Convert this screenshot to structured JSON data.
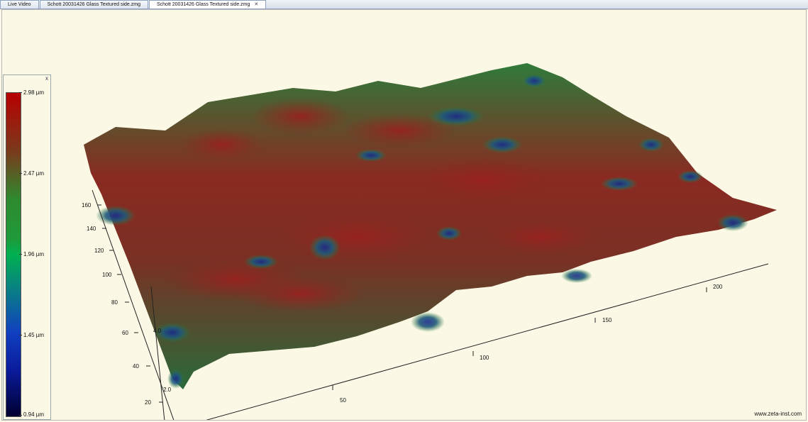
{
  "tabs": [
    {
      "label": "Live Video",
      "active": false
    },
    {
      "label": "Schott 20031426 Glass Textured side.zmg",
      "active": false
    },
    {
      "label": "Schott 20031426 Glass Textured side.zmg",
      "active": true,
      "close": "✕"
    }
  ],
  "colorbar": {
    "close": "x",
    "labels": {
      "top": "2.98 µm",
      "l2": "2.47 µm",
      "l3": "1.96 µm",
      "l4": "1.45 µm",
      "bottom": "0.94 µm"
    }
  },
  "axes": {
    "y_ticks": [
      "160",
      "140",
      "120",
      "100",
      "80",
      "60",
      "40",
      "20"
    ],
    "x_ticks": [
      "50",
      "100",
      "150",
      "200"
    ],
    "z_ticks": [
      "4.0",
      "2.0"
    ]
  },
  "watermark": "www.zeta-inst.com",
  "colors": {
    "background": "#fbf9e6",
    "surface_high": "#8a2a22",
    "surface_mid": "#2f7a3a",
    "surface_low": "#1c3c8a"
  }
}
